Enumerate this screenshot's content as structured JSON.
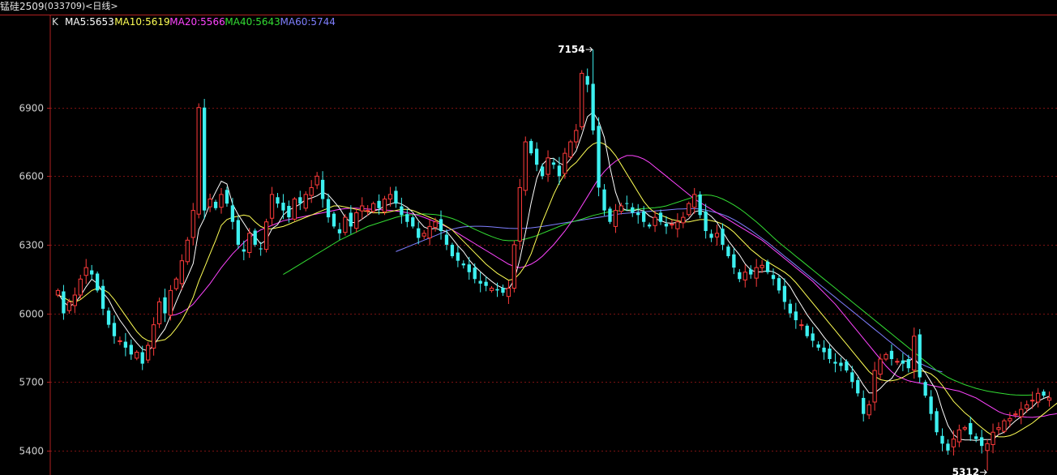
{
  "header": {
    "instrument": "锰硅2509",
    "code": "(033709)",
    "period": "<日线>"
  },
  "colors": {
    "up": "#ff3b3b",
    "down": "#3df0f0",
    "grid": "#7a1212",
    "axis": "#b02020",
    "tick_text": "#cfcfcf",
    "ma5": "#ffffff",
    "ma10": "#ffff55",
    "ma20": "#ff44ff",
    "ma40": "#33dd33",
    "ma60": "#7f7fff"
  },
  "chart_data": {
    "type": "candlestick",
    "ylim": [
      5300,
      7250
    ],
    "yticks": [
      6900,
      6600,
      6300,
      6000,
      5700,
      5400
    ],
    "grid": "horizontal dotted",
    "legend_prefix": "K",
    "legend": [
      {
        "key": "ma5",
        "label": "MA5:5653"
      },
      {
        "key": "ma10",
        "label": "MA10:5619"
      },
      {
        "key": "ma20",
        "label": "MA20:5566"
      },
      {
        "key": "ma40",
        "label": "MA40:5643"
      },
      {
        "key": "ma60",
        "label": "MA60:5744"
      }
    ],
    "annotations": [
      {
        "text": "7154",
        "value": 7154,
        "type": "high"
      },
      {
        "text": "5312",
        "value": 5312,
        "type": "low"
      }
    ],
    "close": [
      6100,
      6000,
      6050,
      6080,
      6150,
      6200,
      6170,
      6100,
      6020,
      5950,
      5900,
      5880,
      5850,
      5820,
      5830,
      5780,
      5860,
      5950,
      6050,
      6000,
      6100,
      6150,
      6230,
      6320,
      6450,
      6900,
      6450,
      6500,
      6460,
      6520,
      6480,
      6400,
      6300,
      6270,
      6350,
      6300,
      6280,
      6400,
      6520,
      6480,
      6450,
      6420,
      6500,
      6480,
      6520,
      6550,
      6600,
      6500,
      6420,
      6380,
      6350,
      6420,
      6380,
      6440,
      6470,
      6450,
      6480,
      6460,
      6500,
      6520,
      6480,
      6430,
      6400,
      6380,
      6330,
      6350,
      6380,
      6400,
      6360,
      6300,
      6250,
      6230,
      6210,
      6180,
      6150,
      6130,
      6120,
      6110,
      6100,
      6090,
      6110,
      6300,
      6550,
      6750,
      6700,
      6650,
      6600,
      6680,
      6650,
      6600,
      6700,
      6750,
      6800,
      7050,
      7000,
      6800,
      6550,
      6450,
      6400,
      6450,
      6470,
      6480,
      6440,
      6430,
      6400,
      6380,
      6420,
      6400,
      6380,
      6390,
      6400,
      6420,
      6480,
      6520,
      6430,
      6360,
      6330,
      6350,
      6300,
      6250,
      6200,
      6150,
      6180,
      6170,
      6200,
      6210,
      6180,
      6150,
      6100,
      6050,
      6000,
      5970,
      5950,
      5900,
      5880,
      5850,
      5830,
      5800,
      5780,
      5770,
      5750,
      5700,
      5650,
      5560,
      5600,
      5750,
      5800,
      5820,
      5800,
      5790,
      5780,
      5760,
      5900,
      5720,
      5640,
      5560,
      5480,
      5430,
      5400,
      5450,
      5490,
      5500,
      5470,
      5450,
      5420,
      5430,
      5480,
      5500,
      5530,
      5540,
      5560,
      5580,
      5600,
      5620,
      5650,
      5640,
      5630
    ],
    "ma5": [
      6090,
      6050,
      6030,
      6045,
      6076,
      6116,
      6150,
      6130,
      6090,
      6060,
      6012,
      5970,
      5936,
      5900,
      5870,
      5843,
      5836,
      5860,
      5898,
      5932,
      5990,
      6051,
      6108,
      6160,
      6218,
      6366,
      6416,
      6480,
      6531,
      6578,
      6566,
      6478,
      6432,
      6394,
      6356,
      6336,
      6304,
      6320,
      6370,
      6388,
      6430,
      6452,
      6464,
      6478,
      6498,
      6504,
      6514,
      6530,
      6518,
      6490,
      6460,
      6420,
      6398,
      6396,
      6412,
      6430,
      6448,
      6454,
      6470,
      6478,
      6486,
      6478,
      6464,
      6442,
      6406,
      6378,
      6368,
      6372,
      6364,
      6358,
      6328,
      6296,
      6270,
      6234,
      6206,
      6182,
      6160,
      6140,
      6122,
      6110,
      6106,
      6146,
      6236,
      6354,
      6482,
      6590,
      6650,
      6676,
      6678,
      6658,
      6646,
      6676,
      6710,
      6780,
      6860,
      6880,
      6840,
      6770,
      6640,
      6530,
      6462,
      6450,
      6448,
      6454,
      6448,
      6426,
      6414,
      6406,
      6396,
      6394,
      6398,
      6398,
      6414,
      6444,
      6450,
      6442,
      6424,
      6398,
      6358,
      6318,
      6286,
      6256,
      6216,
      6190,
      6180,
      6182,
      6186,
      6182,
      6168,
      6146,
      6116,
      6074,
      6034,
      5994,
      5960,
      5930,
      5896,
      5866,
      5838,
      5814,
      5790,
      5760,
      5726,
      5686,
      5652,
      5652,
      5672,
      5698,
      5714,
      5752,
      5792,
      5790,
      5806,
      5770,
      5740,
      5700,
      5660,
      5578,
      5510,
      5470,
      5450,
      5446,
      5446,
      5444,
      5448,
      5448,
      5448,
      5470,
      5480,
      5508,
      5530,
      5548,
      5572,
      5590,
      5616,
      5628,
      5637
    ],
    "ma10": [
      6080,
      6070,
      6055,
      6048,
      6060,
      6080,
      6100,
      6110,
      6105,
      6090,
      6060,
      6025,
      5990,
      5955,
      5920,
      5895,
      5880,
      5875,
      5880,
      5885,
      5905,
      5935,
      5970,
      6015,
      6070,
      6140,
      6200,
      6260,
      6320,
      6385,
      6410,
      6420,
      6425,
      6430,
      6425,
      6400,
      6380,
      6370,
      6370,
      6375,
      6380,
      6390,
      6400,
      6410,
      6420,
      6430,
      6440,
      6450,
      6460,
      6470,
      6470,
      6465,
      6460,
      6455,
      6450,
      6445,
      6440,
      6440,
      6440,
      6445,
      6450,
      6455,
      6455,
      6450,
      6440,
      6430,
      6420,
      6410,
      6395,
      6380,
      6365,
      6340,
      6315,
      6290,
      6265,
      6240,
      6215,
      6195,
      6175,
      6160,
      6145,
      6150,
      6175,
      6210,
      6260,
      6330,
      6400,
      6460,
      6520,
      6570,
      6610,
      6640,
      6660,
      6690,
      6720,
      6740,
      6750,
      6740,
      6720,
      6690,
      6650,
      6610,
      6570,
      6530,
      6490,
      6460,
      6440,
      6430,
      6420,
      6410,
      6405,
      6400,
      6400,
      6405,
      6410,
      6410,
      6405,
      6400,
      6390,
      6375,
      6355,
      6330,
      6305,
      6280,
      6260,
      6240,
      6225,
      6210,
      6195,
      6180,
      6160,
      6135,
      6105,
      6075,
      6045,
      6015,
      5985,
      5955,
      5925,
      5895,
      5865,
      5835,
      5805,
      5775,
      5745,
      5725,
      5710,
      5705,
      5705,
      5710,
      5720,
      5735,
      5745,
      5750,
      5745,
      5735,
      5715,
      5685,
      5650,
      5615,
      5590,
      5565,
      5545,
      5520,
      5500,
      5480,
      5465,
      5460,
      5460,
      5465,
      5475,
      5490,
      5505,
      5520,
      5540,
      5560,
      5580,
      5600,
      5619
    ],
    "ma20": [
      null,
      null,
      null,
      null,
      null,
      null,
      null,
      null,
      null,
      null,
      null,
      null,
      null,
      null,
      null,
      null,
      null,
      null,
      null,
      null,
      5990,
      5995,
      6005,
      6020,
      6040,
      6070,
      6100,
      6130,
      6165,
      6200,
      6230,
      6260,
      6285,
      6310,
      6330,
      6350,
      6365,
      6375,
      6385,
      6395,
      6405,
      6410,
      6415,
      6420,
      6425,
      6430,
      6435,
      6440,
      6445,
      6450,
      6455,
      6458,
      6460,
      6460,
      6458,
      6456,
      6455,
      6454,
      6452,
      6450,
      6448,
      6445,
      6440,
      6435,
      6428,
      6420,
      6410,
      6400,
      6390,
      6378,
      6365,
      6350,
      6335,
      6320,
      6305,
      6290,
      6275,
      6260,
      6245,
      6230,
      6215,
      6205,
      6200,
      6205,
      6215,
      6230,
      6250,
      6275,
      6300,
      6330,
      6360,
      6395,
      6430,
      6470,
      6510,
      6550,
      6590,
      6620,
      6645,
      6665,
      6680,
      6690,
      6690,
      6685,
      6675,
      6660,
      6640,
      6620,
      6600,
      6580,
      6560,
      6540,
      6520,
      6500,
      6485,
      6470,
      6455,
      6440,
      6425,
      6410,
      6395,
      6380,
      6365,
      6350,
      6335,
      6320,
      6300,
      6280,
      6260,
      6240,
      6220,
      6200,
      6180,
      6160,
      6140,
      6115,
      6090,
      6065,
      6040,
      6010,
      5980,
      5950,
      5920,
      5890,
      5860,
      5830,
      5800,
      5770,
      5745,
      5725,
      5715,
      5705,
      5700,
      5695,
      5690,
      5685,
      5680,
      5675,
      5670,
      5665,
      5660,
      5650,
      5640,
      5630,
      5615,
      5600,
      5585,
      5570,
      5560,
      5555,
      5550,
      5548,
      5546,
      5545,
      5548,
      5550,
      5556,
      5560,
      5566
    ],
    "ma40": [
      null,
      null,
      null,
      null,
      null,
      null,
      null,
      null,
      null,
      null,
      null,
      null,
      null,
      null,
      null,
      null,
      null,
      null,
      null,
      null,
      null,
      null,
      null,
      null,
      null,
      null,
      null,
      null,
      null,
      null,
      null,
      null,
      null,
      null,
      null,
      null,
      null,
      null,
      null,
      null,
      6170,
      6185,
      6200,
      6215,
      6230,
      6245,
      6260,
      6275,
      6290,
      6305,
      6320,
      6332,
      6344,
      6356,
      6368,
      6380,
      6388,
      6396,
      6404,
      6412,
      6420,
      6426,
      6430,
      6432,
      6434,
      6435,
      6434,
      6432,
      6428,
      6422,
      6415,
      6405,
      6393,
      6380,
      6368,
      6357,
      6346,
      6336,
      6327,
      6320,
      6318,
      6318,
      6320,
      6325,
      6332,
      6340,
      6350,
      6360,
      6370,
      6380,
      6390,
      6398,
      6405,
      6412,
      6420,
      6428,
      6434,
      6440,
      6444,
      6447,
      6450,
      6452,
      6454,
      6456,
      6458,
      6460,
      6462,
      6465,
      6470,
      6478,
      6486,
      6494,
      6502,
      6510,
      6516,
      6518,
      6516,
      6510,
      6500,
      6488,
      6474,
      6458,
      6440,
      6420,
      6400,
      6378,
      6355,
      6332,
      6310,
      6290,
      6270,
      6250,
      6230,
      6210,
      6190,
      6170,
      6150,
      6130,
      6110,
      6090,
      6070,
      6050,
      6030,
      6010,
      5990,
      5970,
      5950,
      5930,
      5910,
      5890,
      5870,
      5850,
      5830,
      5810,
      5790,
      5770,
      5750,
      5735,
      5720,
      5708,
      5698,
      5688,
      5680,
      5672,
      5666,
      5660,
      5656,
      5652,
      5648,
      5645,
      5643,
      5642,
      5642,
      5643
    ],
    "ma60": [
      null,
      null,
      null,
      null,
      null,
      null,
      null,
      null,
      null,
      null,
      null,
      null,
      null,
      null,
      null,
      null,
      null,
      null,
      null,
      null,
      null,
      null,
      null,
      null,
      null,
      null,
      null,
      null,
      null,
      null,
      null,
      null,
      null,
      null,
      null,
      null,
      null,
      null,
      null,
      null,
      null,
      null,
      null,
      null,
      null,
      null,
      null,
      null,
      null,
      null,
      null,
      null,
      null,
      null,
      null,
      null,
      null,
      null,
      null,
      null,
      6270,
      6280,
      6290,
      6300,
      6310,
      6320,
      6330,
      6340,
      6350,
      6360,
      6368,
      6374,
      6378,
      6380,
      6381,
      6381,
      6380,
      6378,
      6376,
      6374,
      6372,
      6371,
      6371,
      6372,
      6374,
      6377,
      6380,
      6384,
      6388,
      6392,
      6396,
      6400,
      6404,
      6408,
      6412,
      6416,
      6420,
      6424,
      6428,
      6432,
      6436,
      6438,
      6440,
      6442,
      6444,
      6446,
      6448,
      6450,
      6452,
      6454,
      6456,
      6457,
      6458,
      6458,
      6456,
      6452,
      6446,
      6440,
      6432,
      6422,
      6410,
      6396,
      6380,
      6364,
      6346,
      6328,
      6310,
      6290,
      6270,
      6250,
      6230,
      6210,
      6190,
      6170,
      6150,
      6130,
      6110,
      6090,
      6070,
      6050,
      6030,
      6010,
      5990,
      5970,
      5950,
      5930,
      5910,
      5890,
      5870,
      5850,
      5830,
      5810,
      5795,
      5782,
      5770,
      5760,
      5750,
      5744
    ]
  }
}
